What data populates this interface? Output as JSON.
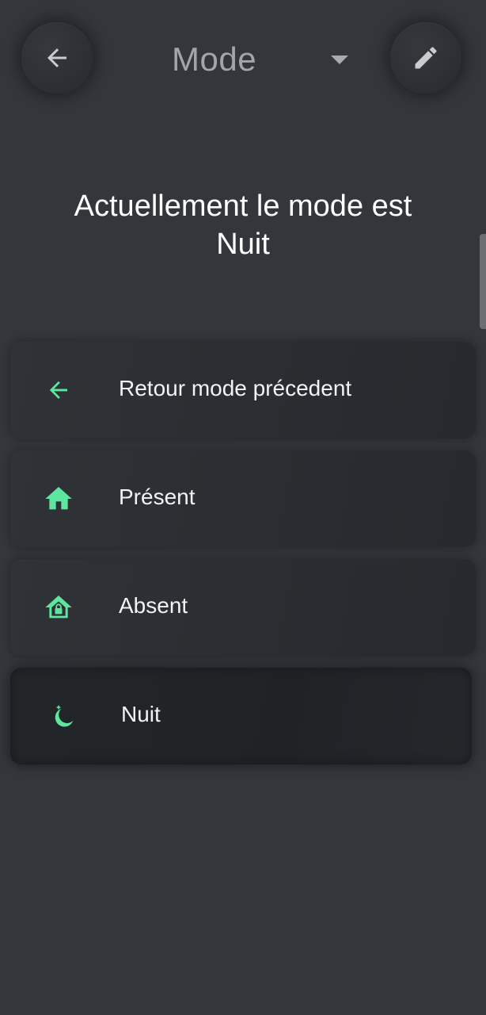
{
  "header": {
    "title": "Mode",
    "back_icon": "arrow-left-icon",
    "edit_icon": "pencil-icon"
  },
  "status": {
    "line1": "Actuellement le mode est",
    "line2": "Nuit"
  },
  "modes": [
    {
      "label": "Retour mode précedent",
      "icon": "arrow-left-icon"
    },
    {
      "label": "Présent",
      "icon": "home-icon"
    },
    {
      "label": "Absent",
      "icon": "home-lock-icon"
    },
    {
      "label": "Nuit",
      "icon": "moon-icon",
      "active": true
    }
  ],
  "colors": {
    "background": "#33363b",
    "accent": "#5ee6a1",
    "card": "#2c2f33"
  }
}
